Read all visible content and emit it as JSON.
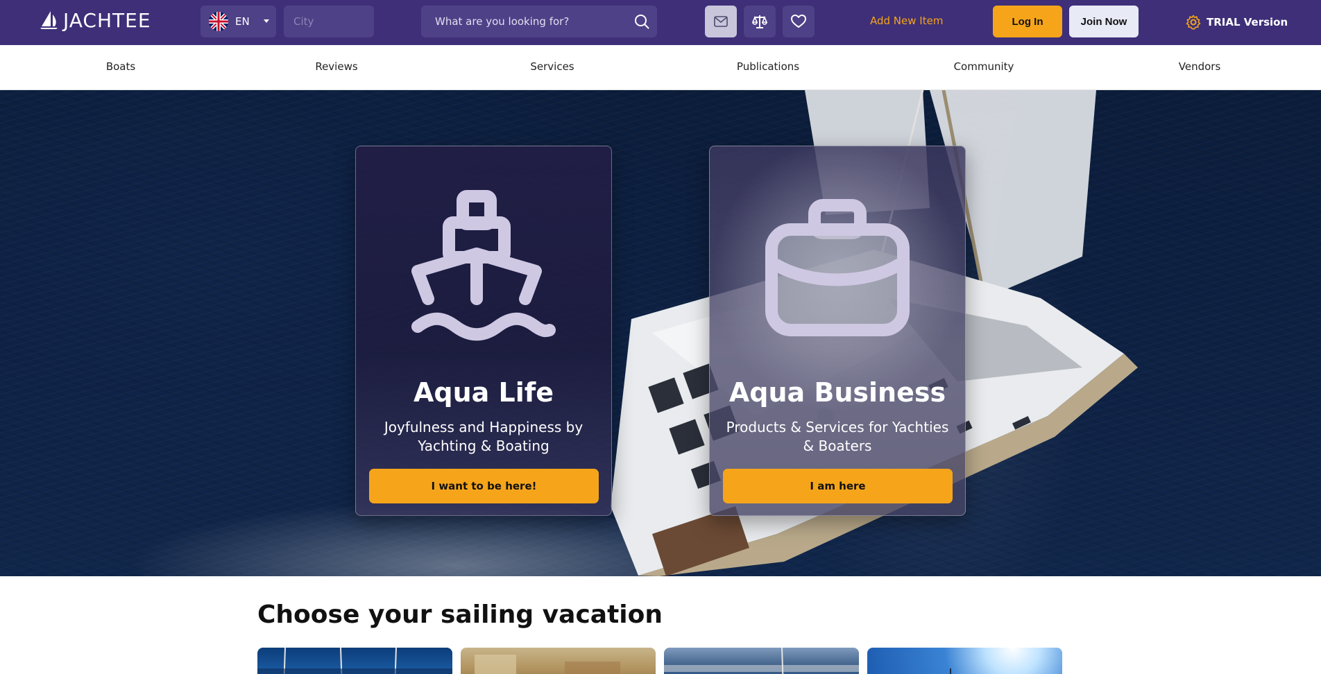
{
  "brand": {
    "logo_text": "JACHTEE",
    "accent": "#f6a51b",
    "header_bg": "#3e2f78"
  },
  "header": {
    "language": {
      "code": "EN",
      "flag": "uk-flag-icon"
    },
    "city": {
      "placeholder": "City",
      "value": ""
    },
    "search": {
      "placeholder": "What are you looking for?",
      "icon": "search-icon"
    },
    "icons": [
      "mail-icon",
      "scales-icon",
      "heart-icon"
    ],
    "add_item_label": "Add New Item",
    "login_label": "Log In",
    "join_label": "Join Now",
    "trial_label": "TRIAL Version",
    "trial_icon": "gear-icon"
  },
  "nav": {
    "items": [
      "Boats",
      "Reviews",
      "Services",
      "Publications",
      "Community",
      "Vendors"
    ]
  },
  "hero": {
    "cards": [
      {
        "title": "Aqua Life",
        "subtitle": "Joyfulness and Happiness by Yachting & Boating",
        "cta": "I want to be here!",
        "icon": "ship-icon"
      },
      {
        "title": "Aqua Business",
        "subtitle": "Products & Services for Yachties & Boaters",
        "cta": "I am here",
        "icon": "briefcase-icon"
      }
    ]
  },
  "section": {
    "title": "Choose your sailing vacation"
  }
}
